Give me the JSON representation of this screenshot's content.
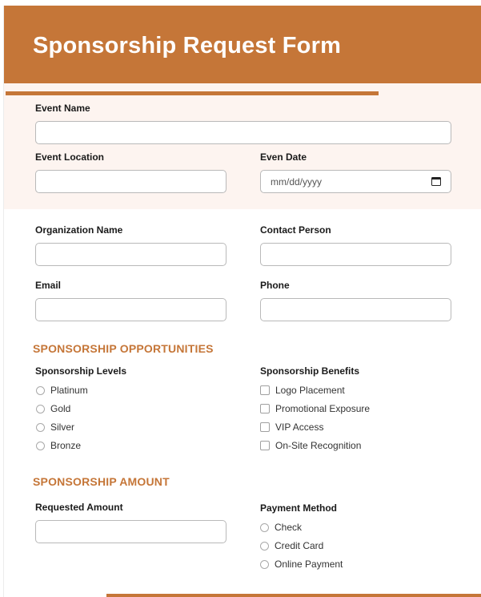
{
  "form": {
    "title": "Sponsorship Request Form",
    "accent_color": "#c57638",
    "tint_color": "#fdf4f0"
  },
  "event": {
    "event_name_label": "Event Name",
    "event_name_value": "",
    "event_location_label": "Event Location",
    "event_location_value": "",
    "event_date_label": "Even Date",
    "event_date_placeholder": "mm/dd/yyyy"
  },
  "contact": {
    "organization_label": "Organization Name",
    "organization_value": "",
    "contact_person_label": "Contact Person",
    "contact_person_value": "",
    "email_label": "Email",
    "email_value": "",
    "phone_label": "Phone",
    "phone_value": ""
  },
  "opportunities": {
    "section_title": "SPONSORSHIP OPPORTUNITIES",
    "levels_label": "Sponsorship Levels",
    "levels": [
      {
        "label": "Platinum",
        "selected": false
      },
      {
        "label": "Gold",
        "selected": false
      },
      {
        "label": "Silver",
        "selected": false
      },
      {
        "label": "Bronze",
        "selected": false
      }
    ],
    "benefits_label": "Sponsorship Benefits",
    "benefits": [
      {
        "label": "Logo Placement",
        "checked": false
      },
      {
        "label": "Promotional Exposure",
        "checked": false
      },
      {
        "label": "VIP Access",
        "checked": false
      },
      {
        "label": "On-Site Recognition",
        "checked": false
      }
    ]
  },
  "amount": {
    "section_title": "SPONSORSHIP AMOUNT",
    "requested_amount_label": "Requested Amount",
    "requested_amount_value": "",
    "payment_method_label": "Payment Method",
    "payment_methods": [
      {
        "label": "Check",
        "selected": false
      },
      {
        "label": "Credit Card",
        "selected": false
      },
      {
        "label": "Online Payment",
        "selected": false
      }
    ]
  }
}
